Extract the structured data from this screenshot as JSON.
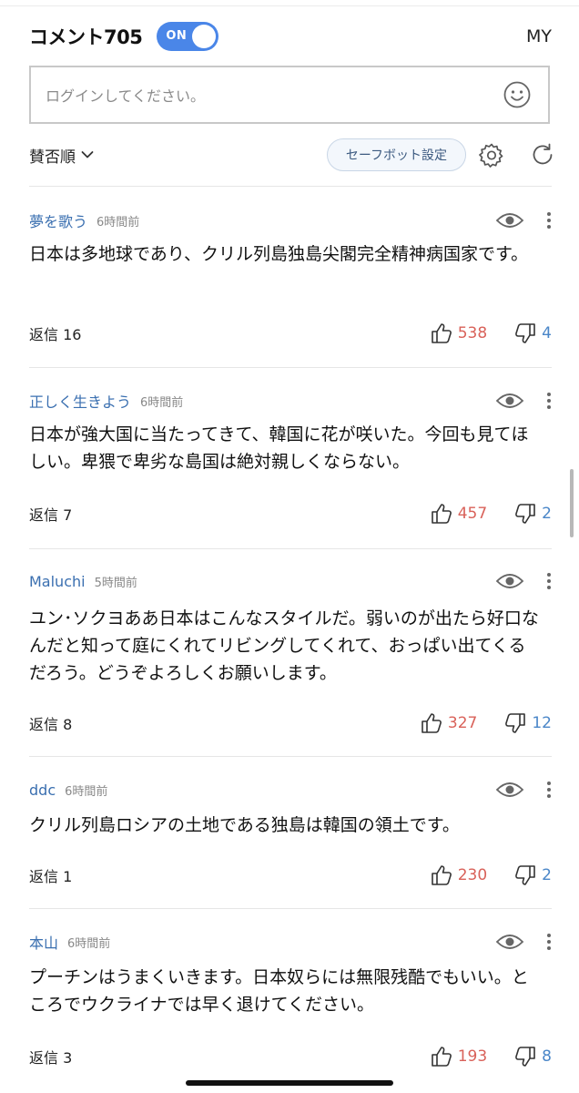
{
  "header": {
    "title": "コメント705",
    "toggle_label": "ON",
    "my_label": "MY"
  },
  "input": {
    "placeholder": "ログインしてください。"
  },
  "toolbar": {
    "sort_label": "賛否順",
    "safebot_label": "セーフボット設定"
  },
  "icons": {
    "emoji": "smiley-icon",
    "settings": "gear-icon",
    "refresh": "refresh-icon",
    "view": "eye-icon",
    "more": "more-vert-icon",
    "like": "thumbs-up-icon",
    "dislike": "thumbs-down-icon",
    "sort": "chevron-down-icon"
  },
  "colors": {
    "accent": "#4a86e8",
    "username": "#3a6fb0",
    "like": "#d9625a",
    "dislike": "#4a86c8"
  },
  "comments": [
    {
      "user": "夢を歌う",
      "time": "6時間前",
      "text": "日本は多地球であり、クリル列島独島尖閣完全精神病国家です。",
      "reply": "返信 16",
      "likes": "538",
      "dislikes": "4"
    },
    {
      "user": "正しく生きよう",
      "time": "6時間前",
      "text": "日本が強大国に当たってきて、韓国に花が咲いた。今回も見てほしい。卑猥で卑劣な島国は絶対親しくならない。",
      "reply": "返信 7",
      "likes": "457",
      "dislikes": "2"
    },
    {
      "user": "Maluchi",
      "time": "5時間前",
      "text": "ユン･ソクヨああ日本はこんなスタイルだ。弱いのが出たら好口なんだと知って庭にくれてリビングしてくれて、おっぱい出てくるだろう。どうぞよろしくお願いします。",
      "reply": "返信 8",
      "likes": "327",
      "dislikes": "12"
    },
    {
      "user": "ddc",
      "time": "6時間前",
      "text": "クリル列島ロシアの土地である独島は韓国の領土です。",
      "reply": "返信 1",
      "likes": "230",
      "dislikes": "2"
    },
    {
      "user": "本山",
      "time": "6時間前",
      "text": "プーチンはうまくいきます。日本奴らには無限残酷でもいい。ところでウクライナでは早く退けてください。",
      "reply": "返信 3",
      "likes": "193",
      "dislikes": "8"
    }
  ]
}
